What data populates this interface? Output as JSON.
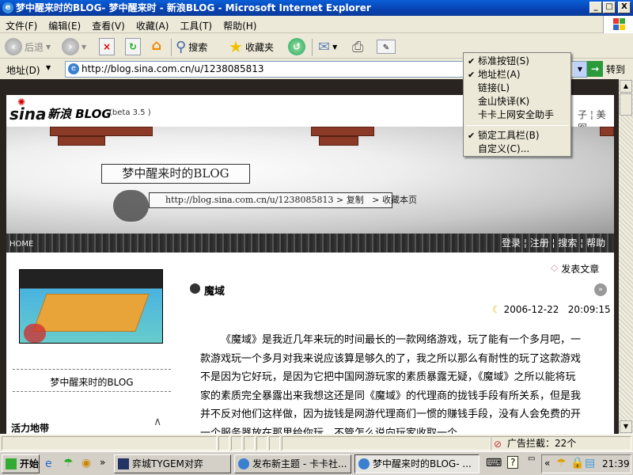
{
  "window": {
    "title": "梦中醒来时的BLOG- 梦中醒来时 - 新浪BLOG - Microsoft Internet Explorer",
    "min": "_",
    "max": "□",
    "close": "X"
  },
  "menubar": [
    "文件(F)",
    "编辑(E)",
    "查看(V)",
    "收藏(A)",
    "工具(T)",
    "帮助(H)"
  ],
  "toolbar": {
    "back": "后退",
    "search": "搜索",
    "favorites": "收藏夹"
  },
  "address": {
    "label": "地址(D)",
    "url": "http://blog.sina.com.cn/u/1238085813",
    "go": "转到"
  },
  "context_menu": {
    "items": [
      {
        "label": "标准按钮(S)",
        "checked": true
      },
      {
        "label": "地址栏(A)",
        "checked": true
      },
      {
        "label": "链接(L)",
        "checked": false
      },
      {
        "label": "金山快译(K)",
        "checked": false
      },
      {
        "label": "卡卡上网安全助手",
        "checked": false
      }
    ],
    "items2": [
      {
        "label": "锁定工具栏(B)",
        "checked": true
      },
      {
        "label": "自定义(C)...",
        "checked": false
      }
    ]
  },
  "page": {
    "logo": "sina",
    "brand": "新浪 BLOG",
    "version": "(beta 3.5 )",
    "top_links": "子 ¦ 美图",
    "blog_title": "梦中醒来时的BLOG",
    "blog_url": "http://blog.sina.com.cn/u/1238085813",
    "copy": "> 复制",
    "bookmark": "> 收藏本页",
    "home": "HOME",
    "nav": [
      "登录",
      "注册",
      "搜索",
      "帮助"
    ],
    "post_article": "发表文章",
    "avatar_caption": "梦中醒来时的BLOG",
    "sidebar_heading": "活力地带",
    "post": {
      "title": "魔域",
      "date": "2006-12-22",
      "time": "20:09:15",
      "body": "《魔域》是我近几年来玩的时间最长的一款网络游戏，玩了能有一个多月吧，一款游戏玩一个多月对我来说应该算是够久的了，我之所以那么有耐性的玩了这款游戏不是因为它好玩，是因为它把中国网游玩家的素质暴露无疑，《魔域》之所以能将玩家的素质完全暴露出来我想这还是同《魔域》的代理商的拢钱手段有所关系，但是我并不反对他们这样做，因为拢钱是网游代理商们一惯的赚钱手段，没有人会免费的开一个服务器放在那里给你玩，不管怎么说向玩家收取一个"
    }
  },
  "status": {
    "popup_block": "广告拦截：22个"
  },
  "taskbar": {
    "start": "开始",
    "more": "»",
    "tasks": [
      "弈城TYGEM对弈",
      "发布新主题 - 卡卡社...",
      "梦中醒来时的BLOG- ..."
    ],
    "tray_more": "«",
    "clock": "21:39"
  }
}
